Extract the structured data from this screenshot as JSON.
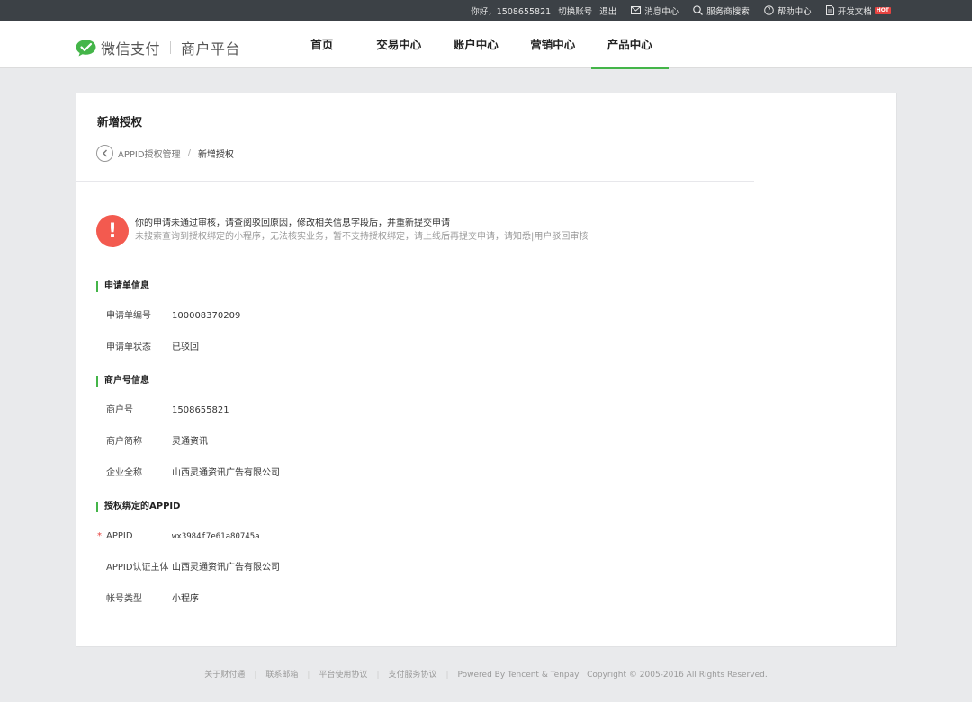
{
  "topbar": {
    "greeting": "你好，1508655821",
    "switch_account": "切换账号",
    "logout": "退出",
    "messages": "消息中心",
    "search_provider": "服务商搜索",
    "help": "帮助中心",
    "docs": "开发文档",
    "docs_badge": "HOT"
  },
  "header": {
    "brand": "微信支付",
    "subtitle": "商户平台",
    "nav": [
      "首页",
      "交易中心",
      "账户中心",
      "营销中心",
      "产品中心"
    ],
    "active_nav": "产品中心"
  },
  "page": {
    "title": "新增授权",
    "breadcrumb_parent": "APPID授权管理",
    "breadcrumb_sep": "/",
    "breadcrumb_current": "新增授权"
  },
  "alert": {
    "icon": "!",
    "title": "你的申请未通过审核，请查阅驳回原因，修改相关信息字段后，并重新提交申请",
    "desc": "未搜索查询到授权绑定的小程序，无法核实业务，暂不支持授权绑定，请上线后再提交申请，请知悉|用户驳回审核"
  },
  "sections": {
    "application": {
      "title": "申请单信息",
      "rows": [
        {
          "label": "申请单编号",
          "value": "100008370209"
        },
        {
          "label": "申请单状态",
          "value": "已驳回"
        }
      ]
    },
    "merchant": {
      "title": "商户号信息",
      "rows": [
        {
          "label": "商户号",
          "value": "1508655821"
        },
        {
          "label": "商户简称",
          "value": "灵通资讯"
        },
        {
          "label": "企业全称",
          "value": "山西灵通资讯广告有限公司"
        }
      ]
    },
    "appid": {
      "title": "授权绑定的APPID",
      "required_mark": "*",
      "rows": [
        {
          "label": "APPID",
          "value": "wx3984f7e61a80745a"
        },
        {
          "label": "APPID认证主体",
          "value": "山西灵通资讯广告有限公司"
        },
        {
          "label": "帐号类型",
          "value": "小程序"
        }
      ]
    }
  },
  "footer": {
    "links": [
      "关于财付通",
      "联系邮箱",
      "平台使用协议",
      "支付服务协议"
    ],
    "powered": "Powered By Tencent & Tenpay",
    "copyright": "Copyright © 2005-2016 All Rights Reserved."
  },
  "colors": {
    "accent": "#44b549",
    "error": "#f35a4f",
    "topbar": "#3c4146"
  }
}
